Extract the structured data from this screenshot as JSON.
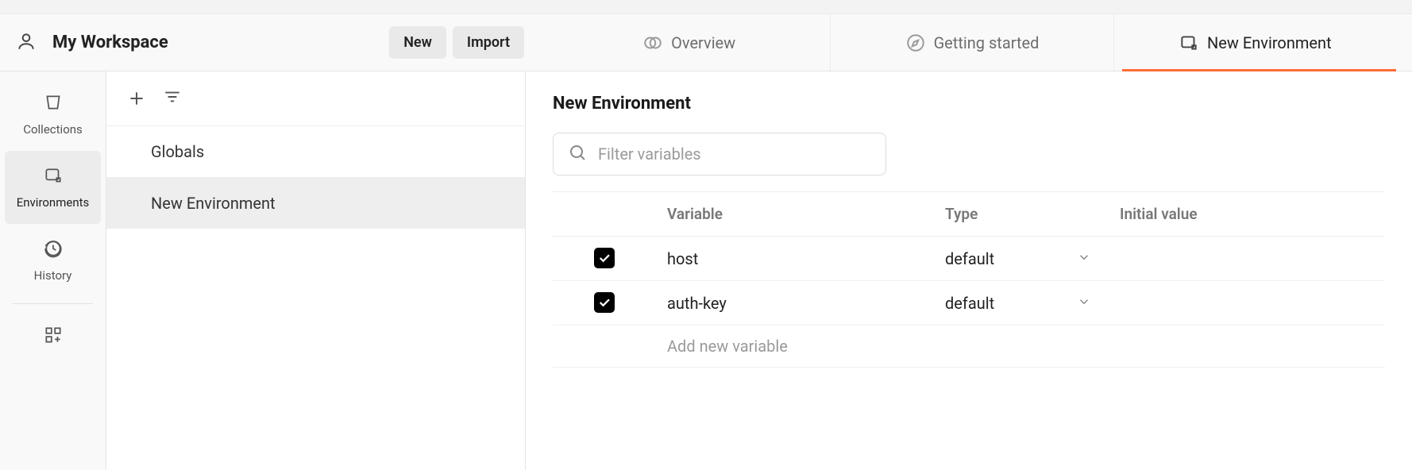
{
  "workspace": {
    "name": "My Workspace"
  },
  "header_buttons": {
    "new": "New",
    "import": "Import"
  },
  "tabs": [
    {
      "label": "Overview",
      "active": false
    },
    {
      "label": "Getting started",
      "active": false
    },
    {
      "label": "New Environment",
      "active": true
    }
  ],
  "rail": {
    "collections": "Collections",
    "environments": "Environments",
    "history": "History"
  },
  "sidebar": {
    "items": [
      {
        "label": "Globals",
        "selected": false
      },
      {
        "label": "New Environment",
        "selected": true
      }
    ]
  },
  "main": {
    "title": "New Environment",
    "filter_placeholder": "Filter variables",
    "columns": {
      "variable": "Variable",
      "type": "Type",
      "initial": "Initial value"
    },
    "rows": [
      {
        "enabled": true,
        "variable": "host",
        "type": "default",
        "initial": ""
      },
      {
        "enabled": true,
        "variable": "auth-key",
        "type": "default",
        "initial": ""
      }
    ],
    "add_placeholder": "Add new variable"
  }
}
